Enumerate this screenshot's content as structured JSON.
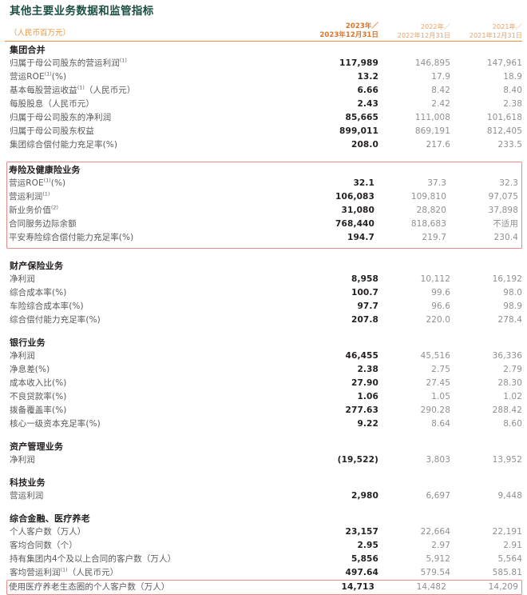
{
  "header": {
    "title": "其他主要业务数据和监管指标",
    "unit": "（人民币百万元）",
    "columns": [
      {
        "year": "2023年／",
        "date": "2023年12月31日"
      },
      {
        "year": "2022年／",
        "date": "2022年12月31日"
      },
      {
        "year": "2021年／",
        "date": "2021年12月31日"
      }
    ],
    "accent_orange": "#e8923c",
    "title_color": "#1b4f43",
    "highlight_color": "#f08a8a"
  },
  "sections": [
    {
      "name": "集团合并",
      "highlight": false,
      "rows": [
        {
          "label": "归属于母公司股东的营运利润",
          "sup": "(1)",
          "values": [
            "117,989",
            "146,895",
            "147,961"
          ]
        },
        {
          "label": "营运ROE",
          "sup": "(1)",
          "label_suffix": "(%)",
          "values": [
            "13.2",
            "17.9",
            "18.9"
          ]
        },
        {
          "label": "基本每股营运收益",
          "sup": "(1)",
          "label_suffix": "（人民币元）",
          "values": [
            "6.66",
            "8.42",
            "8.40"
          ]
        },
        {
          "label": "每股股息（人民币元）",
          "values": [
            "2.43",
            "2.42",
            "2.38"
          ]
        },
        {
          "label": "归属于母公司股东的净利润",
          "values": [
            "85,665",
            "111,008",
            "101,618"
          ]
        },
        {
          "label": "归属于母公司股东权益",
          "values": [
            "899,011",
            "869,191",
            "812,405"
          ]
        },
        {
          "label": "集团综合偿付能力充足率(%)",
          "values": [
            "208.0",
            "217.6",
            "233.5"
          ]
        }
      ]
    },
    {
      "name": "寿险及健康险业务",
      "highlight": true,
      "rows": [
        {
          "label": "营运ROE",
          "sup": "(1)",
          "label_suffix": "(%)",
          "values": [
            "32.1",
            "37.3",
            "32.3"
          ]
        },
        {
          "label": "营运利润",
          "sup": "(1)",
          "values": [
            "106,083",
            "109,810",
            "97,075"
          ]
        },
        {
          "label": "新业务价值",
          "sup": "(2)",
          "values": [
            "31,080",
            "28,820",
            "37,898"
          ]
        },
        {
          "label": "合同服务边际余额",
          "values": [
            "768,440",
            "818,683",
            "不适用"
          ]
        },
        {
          "label": "平安寿险综合偿付能力充足率(%)",
          "values": [
            "194.7",
            "219.7",
            "230.4"
          ]
        }
      ]
    },
    {
      "name": "财产保险业务",
      "highlight": false,
      "rows": [
        {
          "label": "净利润",
          "values": [
            "8,958",
            "10,112",
            "16,192"
          ]
        },
        {
          "label": "综合成本率(%)",
          "values": [
            "100.7",
            "99.6",
            "98.0"
          ]
        },
        {
          "label": "车险综合成本率(%)",
          "values": [
            "97.7",
            "96.6",
            "98.9"
          ]
        },
        {
          "label": "综合偿付能力充足率(%)",
          "values": [
            "207.8",
            "220.0",
            "278.4"
          ]
        }
      ]
    },
    {
      "name": "银行业务",
      "highlight": false,
      "rows": [
        {
          "label": "净利润",
          "values": [
            "46,455",
            "45,516",
            "36,336"
          ]
        },
        {
          "label": "净息差(%)",
          "values": [
            "2.38",
            "2.75",
            "2.79"
          ]
        },
        {
          "label": "成本收入比(%)",
          "values": [
            "27.90",
            "27.45",
            "28.30"
          ]
        },
        {
          "label": "不良贷款率(%)",
          "values": [
            "1.06",
            "1.05",
            "1.02"
          ]
        },
        {
          "label": "拨备覆盖率(%)",
          "values": [
            "277.63",
            "290.28",
            "288.42"
          ]
        },
        {
          "label": "核心一级资本充足率(%)",
          "values": [
            "9.22",
            "8.64",
            "8.60"
          ]
        }
      ]
    },
    {
      "name": "资产管理业务",
      "highlight": false,
      "rows": [
        {
          "label": "净利润",
          "values": [
            "(19,522)",
            "3,803",
            "13,952"
          ]
        }
      ]
    },
    {
      "name": "科技业务",
      "highlight": false,
      "rows": [
        {
          "label": "营运利润",
          "values": [
            "2,980",
            "6,697",
            "9,448"
          ]
        }
      ]
    },
    {
      "name": "综合金融、医疗养老",
      "highlight": false,
      "rows": [
        {
          "label": "个人客户数（万人）",
          "values": [
            "23,157",
            "22,664",
            "22,191"
          ]
        },
        {
          "label": "客均合同数（个）",
          "values": [
            "2.95",
            "2.97",
            "2.91"
          ]
        },
        {
          "label": "持有集团内4个及以上合同的客户数（万人）",
          "values": [
            "5,856",
            "5,912",
            "5,564"
          ]
        },
        {
          "label": "客均营运利润",
          "sup": "(1)",
          "label_suffix": "（人民币元）",
          "values": [
            "497.64",
            "579.54",
            "585.81"
          ]
        },
        {
          "label": "使用医疗养老生态圈的个人客户数（万人）",
          "row_highlight": true,
          "values": [
            "14,713",
            "14,482",
            "14,209"
          ]
        }
      ]
    }
  ]
}
